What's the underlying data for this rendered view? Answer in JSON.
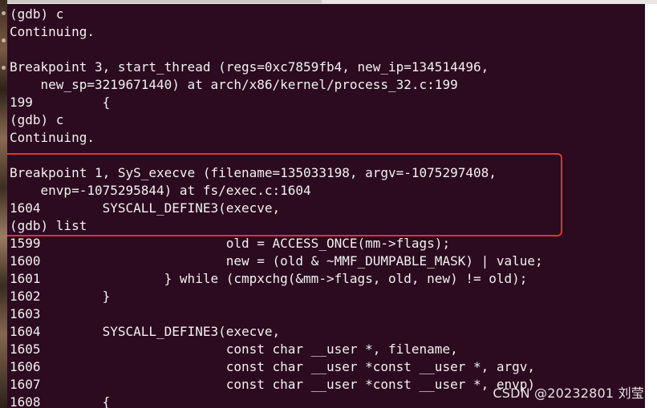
{
  "terminal": {
    "lines": [
      "(gdb) c",
      "Continuing.",
      "",
      "Breakpoint 3, start_thread (regs=0xc7859fb4, new_ip=134514496,",
      "    new_sp=3219671440) at arch/x86/kernel/process_32.c:199",
      "199\t    {",
      "(gdb) c",
      "Continuing.",
      "",
      "Breakpoint 1, SyS_execve (filename=135033198, argv=-1075297408,",
      "    envp=-1075295844) at fs/exec.c:1604",
      "1604\t    SYSCALL_DEFINE3(execve,",
      "(gdb) list",
      "1599\t\t\t    old = ACCESS_ONCE(mm->flags);",
      "1600\t\t\t    new = (old & ~MMF_DUMPABLE_MASK) | value;",
      "1601\t\t    } while (cmpxchg(&mm->flags, old, new) != old);",
      "1602\t    }",
      "1603",
      "1604\t    SYSCALL_DEFINE3(execve,",
      "1605\t\t\t    const char __user *, filename,",
      "1606\t\t\t    const char __user *const __user *, argv,",
      "1607\t\t\t    const char __user *const __user *, envp)",
      "1608\t    {"
    ]
  },
  "watermark": "CSDN @20232801 刘莹",
  "colors": {
    "terminal_bg": "#2c0a1f",
    "terminal_fg": "#f2f2f2",
    "highlight_border": "#e0342c"
  }
}
